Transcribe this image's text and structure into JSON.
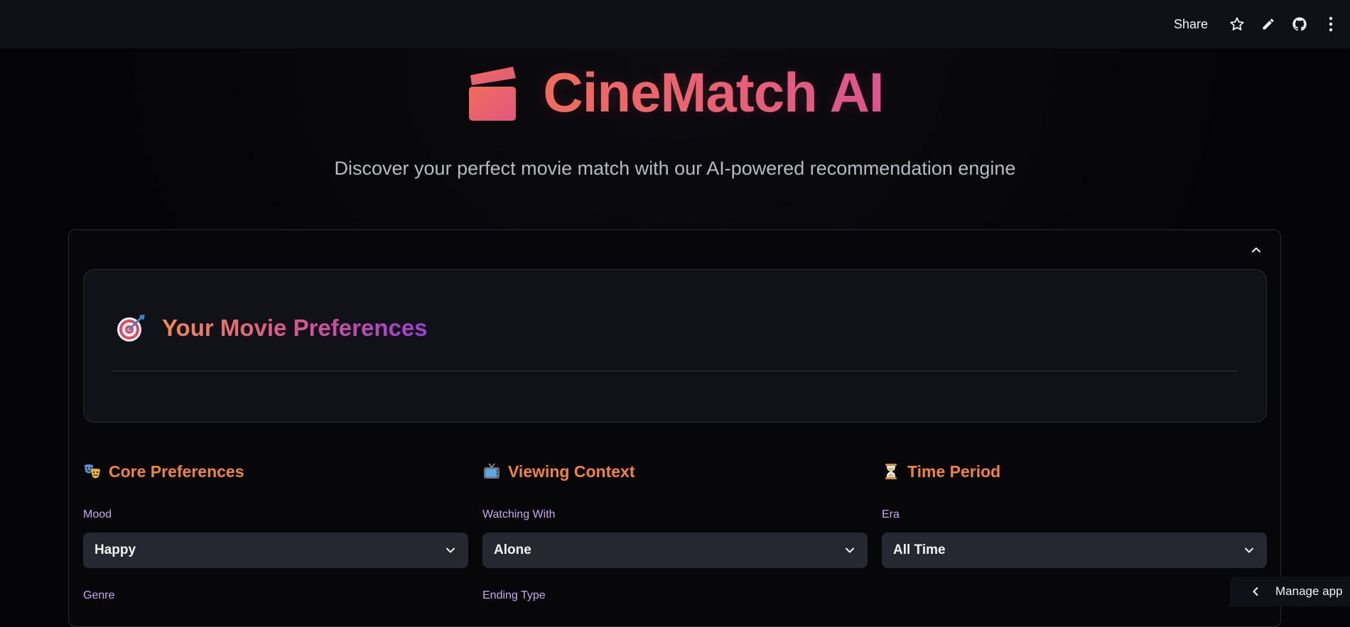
{
  "header": {
    "share_label": "Share"
  },
  "hero": {
    "title": "CineMatch AI",
    "subtitle": "Discover your perfect movie match with our AI-powered recommendation engine"
  },
  "preferences_card": {
    "heading": "Your Movie Preferences"
  },
  "sections": [
    {
      "title": "Core Preferences",
      "fields": [
        {
          "label": "Mood",
          "value": "Happy"
        },
        {
          "label": "Genre"
        }
      ]
    },
    {
      "title": "Viewing Context",
      "fields": [
        {
          "label": "Watching With",
          "value": "Alone"
        },
        {
          "label": "Ending Type"
        }
      ]
    },
    {
      "title": "Time Period",
      "fields": [
        {
          "label": "Era",
          "value": "All Time"
        }
      ]
    }
  ],
  "footer": {
    "manage_label": "Manage app"
  },
  "colors": {
    "accent_orange": "#f0843d",
    "label_purple": "#c9a6f0",
    "select_bg": "#262730",
    "topbar_bg": "#0e1117"
  }
}
